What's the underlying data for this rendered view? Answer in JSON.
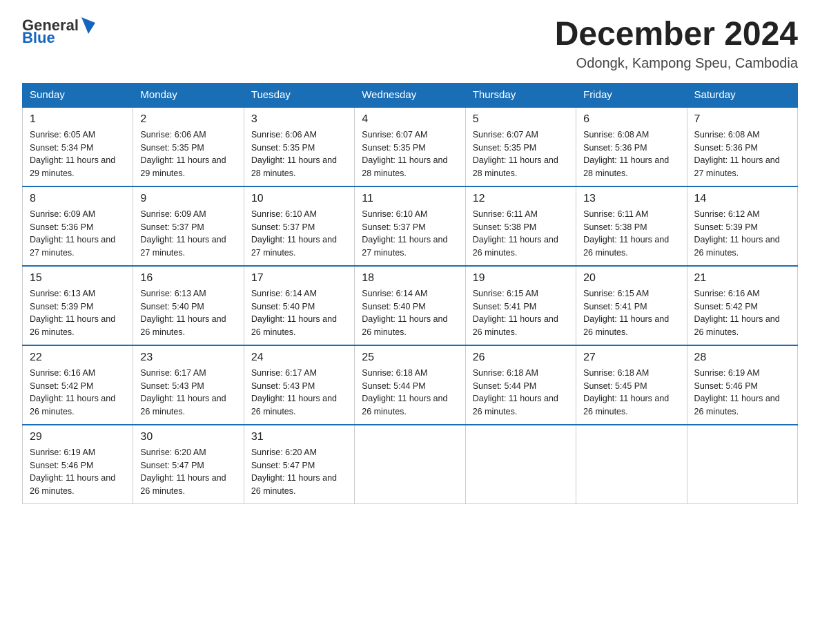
{
  "header": {
    "logo": {
      "text_general": "General",
      "text_blue": "Blue"
    },
    "title": "December 2024",
    "subtitle": "Odongk, Kampong Speu, Cambodia"
  },
  "days_of_week": [
    "Sunday",
    "Monday",
    "Tuesday",
    "Wednesday",
    "Thursday",
    "Friday",
    "Saturday"
  ],
  "weeks": [
    [
      {
        "day": "1",
        "sunrise": "6:05 AM",
        "sunset": "5:34 PM",
        "daylight": "11 hours and 29 minutes."
      },
      {
        "day": "2",
        "sunrise": "6:06 AM",
        "sunset": "5:35 PM",
        "daylight": "11 hours and 29 minutes."
      },
      {
        "day": "3",
        "sunrise": "6:06 AM",
        "sunset": "5:35 PM",
        "daylight": "11 hours and 28 minutes."
      },
      {
        "day": "4",
        "sunrise": "6:07 AM",
        "sunset": "5:35 PM",
        "daylight": "11 hours and 28 minutes."
      },
      {
        "day": "5",
        "sunrise": "6:07 AM",
        "sunset": "5:35 PM",
        "daylight": "11 hours and 28 minutes."
      },
      {
        "day": "6",
        "sunrise": "6:08 AM",
        "sunset": "5:36 PM",
        "daylight": "11 hours and 28 minutes."
      },
      {
        "day": "7",
        "sunrise": "6:08 AM",
        "sunset": "5:36 PM",
        "daylight": "11 hours and 27 minutes."
      }
    ],
    [
      {
        "day": "8",
        "sunrise": "6:09 AM",
        "sunset": "5:36 PM",
        "daylight": "11 hours and 27 minutes."
      },
      {
        "day": "9",
        "sunrise": "6:09 AM",
        "sunset": "5:37 PM",
        "daylight": "11 hours and 27 minutes."
      },
      {
        "day": "10",
        "sunrise": "6:10 AM",
        "sunset": "5:37 PM",
        "daylight": "11 hours and 27 minutes."
      },
      {
        "day": "11",
        "sunrise": "6:10 AM",
        "sunset": "5:37 PM",
        "daylight": "11 hours and 27 minutes."
      },
      {
        "day": "12",
        "sunrise": "6:11 AM",
        "sunset": "5:38 PM",
        "daylight": "11 hours and 26 minutes."
      },
      {
        "day": "13",
        "sunrise": "6:11 AM",
        "sunset": "5:38 PM",
        "daylight": "11 hours and 26 minutes."
      },
      {
        "day": "14",
        "sunrise": "6:12 AM",
        "sunset": "5:39 PM",
        "daylight": "11 hours and 26 minutes."
      }
    ],
    [
      {
        "day": "15",
        "sunrise": "6:13 AM",
        "sunset": "5:39 PM",
        "daylight": "11 hours and 26 minutes."
      },
      {
        "day": "16",
        "sunrise": "6:13 AM",
        "sunset": "5:40 PM",
        "daylight": "11 hours and 26 minutes."
      },
      {
        "day": "17",
        "sunrise": "6:14 AM",
        "sunset": "5:40 PM",
        "daylight": "11 hours and 26 minutes."
      },
      {
        "day": "18",
        "sunrise": "6:14 AM",
        "sunset": "5:40 PM",
        "daylight": "11 hours and 26 minutes."
      },
      {
        "day": "19",
        "sunrise": "6:15 AM",
        "sunset": "5:41 PM",
        "daylight": "11 hours and 26 minutes."
      },
      {
        "day": "20",
        "sunrise": "6:15 AM",
        "sunset": "5:41 PM",
        "daylight": "11 hours and 26 minutes."
      },
      {
        "day": "21",
        "sunrise": "6:16 AM",
        "sunset": "5:42 PM",
        "daylight": "11 hours and 26 minutes."
      }
    ],
    [
      {
        "day": "22",
        "sunrise": "6:16 AM",
        "sunset": "5:42 PM",
        "daylight": "11 hours and 26 minutes."
      },
      {
        "day": "23",
        "sunrise": "6:17 AM",
        "sunset": "5:43 PM",
        "daylight": "11 hours and 26 minutes."
      },
      {
        "day": "24",
        "sunrise": "6:17 AM",
        "sunset": "5:43 PM",
        "daylight": "11 hours and 26 minutes."
      },
      {
        "day": "25",
        "sunrise": "6:18 AM",
        "sunset": "5:44 PM",
        "daylight": "11 hours and 26 minutes."
      },
      {
        "day": "26",
        "sunrise": "6:18 AM",
        "sunset": "5:44 PM",
        "daylight": "11 hours and 26 minutes."
      },
      {
        "day": "27",
        "sunrise": "6:18 AM",
        "sunset": "5:45 PM",
        "daylight": "11 hours and 26 minutes."
      },
      {
        "day": "28",
        "sunrise": "6:19 AM",
        "sunset": "5:46 PM",
        "daylight": "11 hours and 26 minutes."
      }
    ],
    [
      {
        "day": "29",
        "sunrise": "6:19 AM",
        "sunset": "5:46 PM",
        "daylight": "11 hours and 26 minutes."
      },
      {
        "day": "30",
        "sunrise": "6:20 AM",
        "sunset": "5:47 PM",
        "daylight": "11 hours and 26 minutes."
      },
      {
        "day": "31",
        "sunrise": "6:20 AM",
        "sunset": "5:47 PM",
        "daylight": "11 hours and 26 minutes."
      },
      null,
      null,
      null,
      null
    ]
  ]
}
